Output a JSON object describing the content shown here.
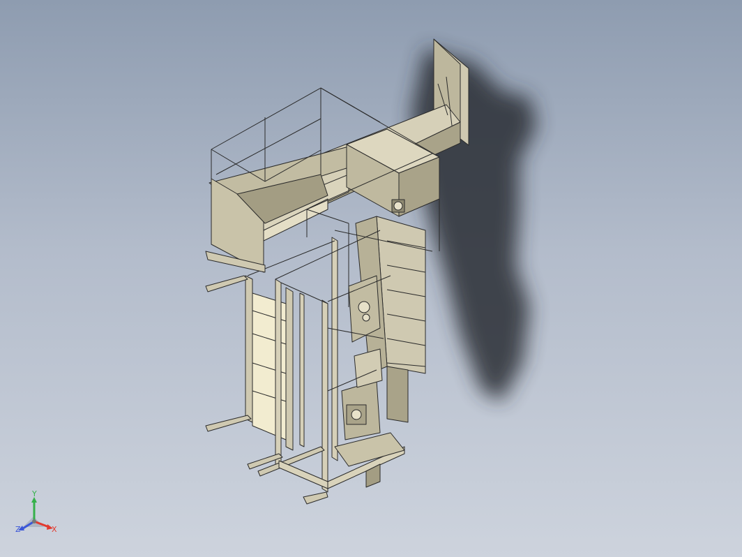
{
  "view": {
    "background_top": "#8e9cb0",
    "background_bottom": "#cdd3dd",
    "model_fill": "#cfc9b1",
    "model_shade": "#a9a389",
    "model_edge": "#2a2a2a",
    "panel_fill": "#f2ecd0",
    "shadow_color": "#2b2e35"
  },
  "triad": {
    "x_label": "X",
    "y_label": "Y",
    "z_label": "Z",
    "x_color": "#e23a2f",
    "y_color": "#35b14a",
    "z_color": "#3a56d8"
  }
}
